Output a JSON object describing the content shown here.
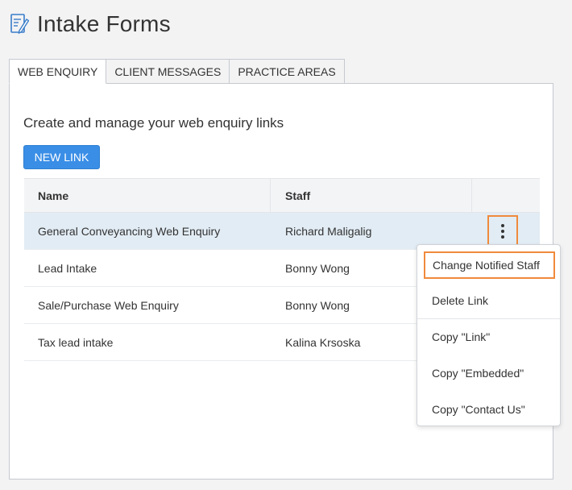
{
  "page": {
    "title": "Intake Forms",
    "title_icon": "form-edit-icon"
  },
  "tabs": [
    {
      "label": "WEB ENQUIRY",
      "active": true
    },
    {
      "label": "CLIENT MESSAGES",
      "active": false
    },
    {
      "label": "PRACTICE AREAS",
      "active": false
    }
  ],
  "panel": {
    "intro": "Create and manage your web enquiry links",
    "new_link_label": "NEW LINK"
  },
  "table": {
    "columns": [
      "Name",
      "Staff",
      ""
    ],
    "rows": [
      {
        "name": "General Conveyancing Web Enquiry",
        "staff": "Richard Maligalig"
      },
      {
        "name": "Lead Intake",
        "staff": "Bonny Wong"
      },
      {
        "name": "Sale/Purchase Web Enquiry",
        "staff": "Bonny Wong"
      },
      {
        "name": "Tax lead intake",
        "staff": "Kalina Krsoska"
      }
    ],
    "selected_row": 0,
    "actions_icon": "vertical-dots-icon"
  },
  "menu": {
    "items": [
      "Change Notified Staff",
      "Delete Link",
      "Copy \"Link\"",
      "Copy \"Embedded\"",
      "Copy \"Contact Us\""
    ]
  },
  "colors": {
    "accent": "#3a8ee6",
    "highlight": "#f08a3c",
    "selected_row": "#e2ecf4"
  }
}
